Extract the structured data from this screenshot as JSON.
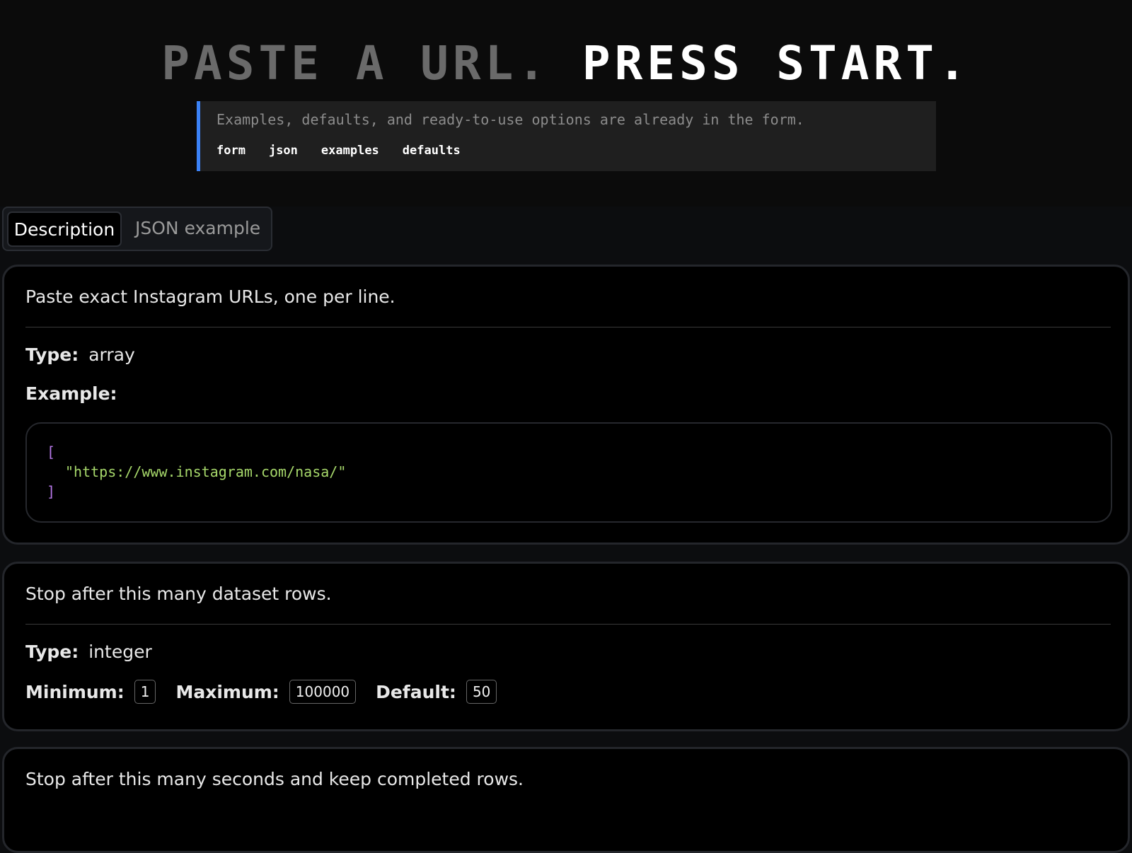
{
  "hero": {
    "title_dim": "PASTE A URL.",
    "title_bright": "PRESS START.",
    "hint_text": "Examples, defaults, and ready-to-use options are already in the form.",
    "links": [
      "form",
      "json",
      "examples",
      "defaults"
    ]
  },
  "tabs": [
    {
      "label": "Description",
      "active": true
    },
    {
      "label": "JSON example",
      "active": false
    }
  ],
  "fields": [
    {
      "description": "Paste exact Instagram URLs, one per line.",
      "type_label": "Type:",
      "type": "array",
      "example_label": "Example:",
      "example_lines": [
        "[",
        "\"https://www.instagram.com/nasa/\"",
        "]"
      ]
    },
    {
      "description": "Stop after this many dataset rows.",
      "type_label": "Type:",
      "type": "integer",
      "minimum_label": "Minimum:",
      "minimum": "1",
      "maximum_label": "Maximum:",
      "maximum": "100000",
      "default_label": "Default:",
      "default": "50"
    },
    {
      "description": "Stop after this many seconds and keep completed rows."
    }
  ],
  "colors": {
    "accent": "#3b82f6",
    "code_bracket": "#b678e8",
    "code_string": "#a6d76a"
  }
}
